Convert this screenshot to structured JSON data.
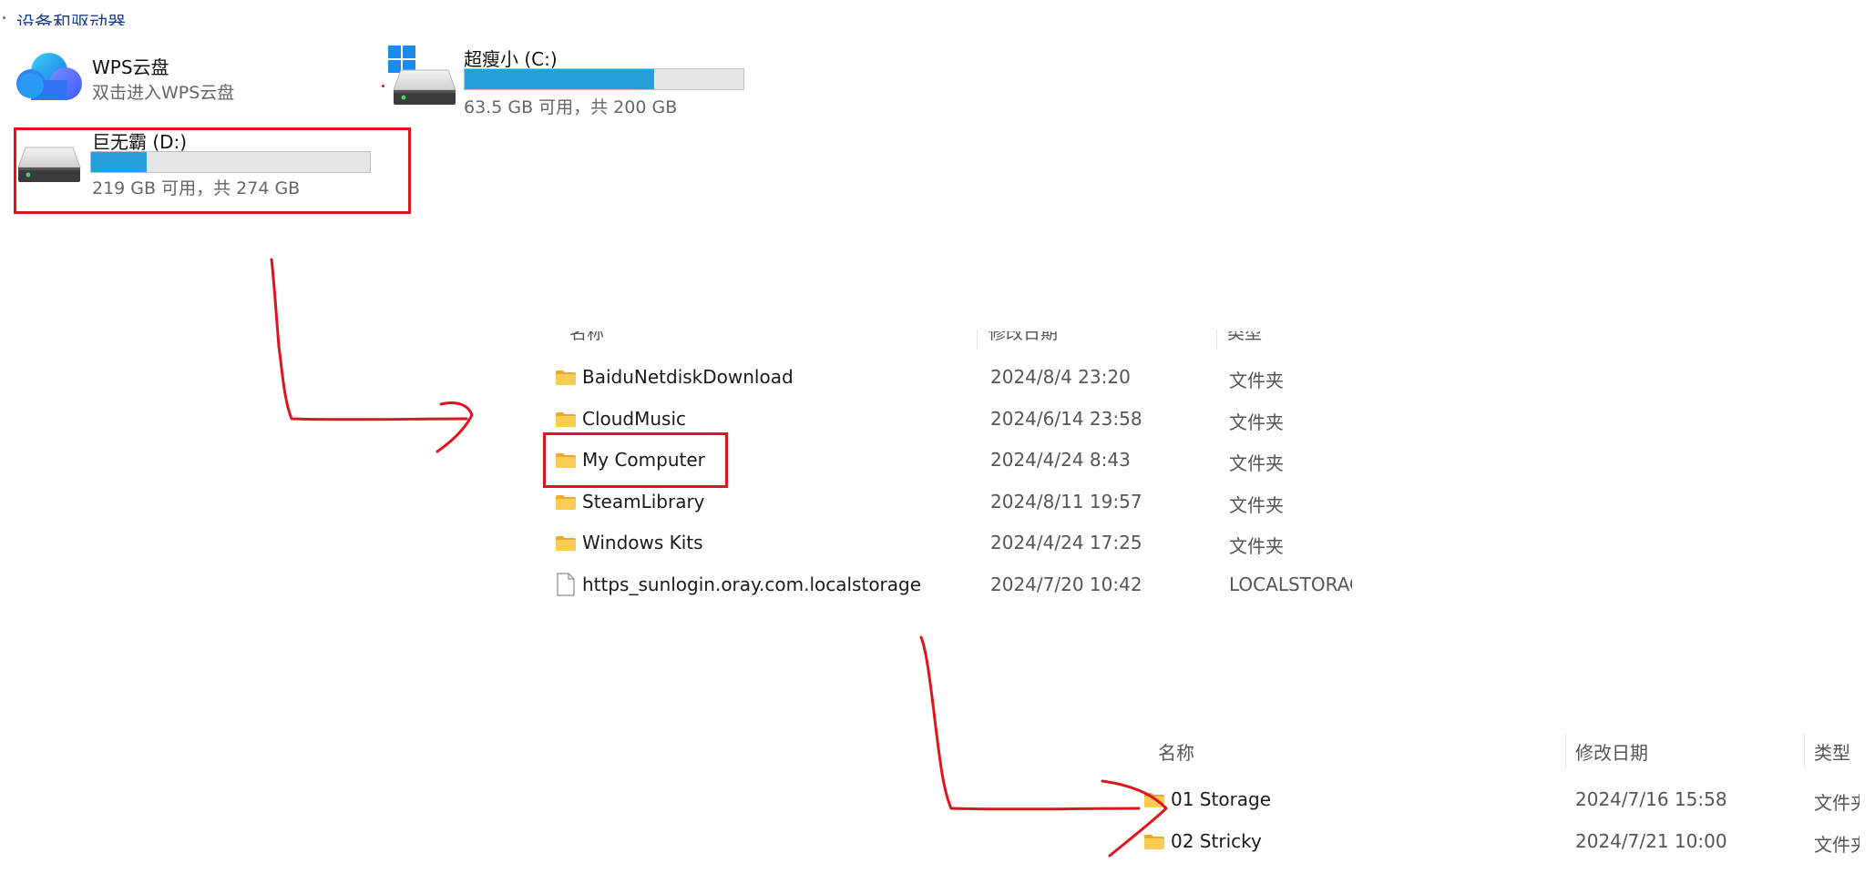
{
  "section_header": "设备和驱动器",
  "drives": [
    {
      "name": "WPS云盘",
      "subtitle": "双击进入WPS云盘"
    },
    {
      "name": "超瘦小 (C:)",
      "subtitle": "63.5 GB 可用，共 200 GB",
      "used_fraction": 0.68
    },
    {
      "name": "巨无霸 (D:)",
      "subtitle": "219 GB 可用，共 274 GB",
      "used_fraction": 0.2
    }
  ],
  "folder_list_1": {
    "headers": [
      "名称",
      "修改日期",
      "类型"
    ],
    "rows": [
      {
        "name": "BaiduNetdiskDownload",
        "date": "2024/8/4 23:20",
        "type": "文件夹",
        "icon": "folder-icon"
      },
      {
        "name": "CloudMusic",
        "date": "2024/6/14 23:58",
        "type": "文件夹",
        "icon": "folder-icon"
      },
      {
        "name": "My Computer",
        "date": "2024/4/24 8:43",
        "type": "文件夹",
        "icon": "folder-icon"
      },
      {
        "name": "SteamLibrary",
        "date": "2024/8/11 19:57",
        "type": "文件夹",
        "icon": "folder-icon"
      },
      {
        "name": "Windows Kits",
        "date": "2024/4/24 17:25",
        "type": "文件夹",
        "icon": "folder-icon"
      },
      {
        "name": "https_sunlogin.oray.com.localstorage",
        "date": "2024/7/20 10:42",
        "type": "LOCALSTORAGE",
        "icon": "file-icon"
      }
    ]
  },
  "folder_list_2": {
    "headers": [
      "名称",
      "修改日期",
      "类型"
    ],
    "rows": [
      {
        "name": "01 Storage",
        "date": "2024/7/16 15:58",
        "type": "文件夹",
        "icon": "folder-icon"
      },
      {
        "name": "02 Stricky",
        "date": "2024/7/21 10:00",
        "type": "文件夹",
        "icon": "folder-icon"
      }
    ]
  },
  "colors": {
    "annotation_red": "#e0141e",
    "capacity_bar": "#26a0da",
    "folder_yellow": "#f4c247"
  }
}
